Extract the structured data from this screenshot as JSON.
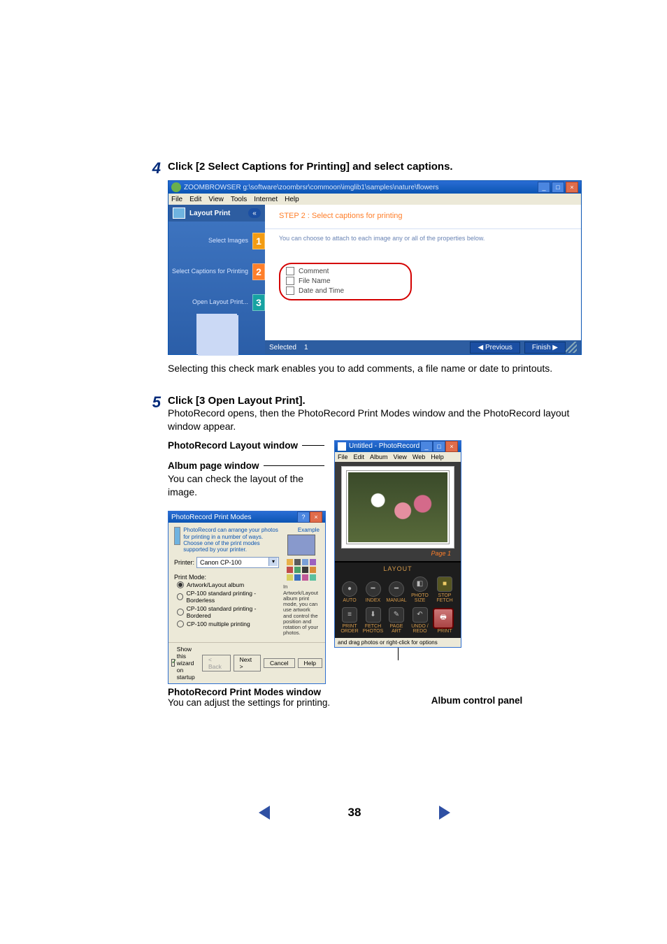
{
  "page_number": "38",
  "step4": {
    "num": "4",
    "title": "Click [2 Select Captions for Printing] and select captions.",
    "caption": "Selecting this check mark enables you to add comments, a file name or date to printouts."
  },
  "step5": {
    "num": "5",
    "title": "Click [3 Open Layout Print].",
    "body": "PhotoRecord opens, then the PhotoRecord Print Modes window and the PhotoRecord layout window appear."
  },
  "labels": {
    "layout_window": "PhotoRecord Layout window",
    "album_page": "Album page window",
    "album_page_desc": "You can check the layout of the image.",
    "print_modes": "PhotoRecord Print Modes window",
    "print_modes_desc": "You can adjust the settings for printing.",
    "album_control": "Album control panel"
  },
  "shot1": {
    "title": "ZOOMBROWSER g:\\software\\zoombrsr\\commoon\\imglib1\\samples\\nature\\flowers",
    "menus": [
      "File",
      "Edit",
      "View",
      "Tools",
      "Internet",
      "Help"
    ],
    "sidebar": {
      "header": "Layout Print",
      "items": [
        {
          "label": "Select Images",
          "num": "1"
        },
        {
          "label": "Select Captions for Printing",
          "num": "2"
        },
        {
          "label": "Open Layout Print...",
          "num": "3"
        }
      ]
    },
    "main": {
      "step_header": "STEP 2 : Select captions for printing",
      "instruction": "You can choose to attach to each image any or all of the properties below.",
      "checks": [
        "Comment",
        "File Name",
        "Date and Time"
      ]
    },
    "status": {
      "selected_label": "Selected",
      "selected_value": "1",
      "previous": "Previous",
      "finish": "Finish"
    },
    "win_buttons": {
      "min": "_",
      "max": "□",
      "close": "×"
    }
  },
  "pmodes": {
    "title": "PhotoRecord Print Modes",
    "intro": "PhotoRecord can arrange your photos for printing in a number of ways. Choose one of the print modes supported by your printer.",
    "printer_label": "Printer:",
    "printer_value": "Canon CP-100",
    "example_label": "Example",
    "mode_label": "Print Mode:",
    "modes": [
      "Artwork/Layout album",
      "CP-100 standard printing - Borderless",
      "CP-100 standard printing - Bordered",
      "CP-100 multiple printing"
    ],
    "mode_note": "In Artwork/Layout album print mode, you can use artwork and control the position and rotation of your photos.",
    "show_wizard": "Show this wizard on startup",
    "buttons": {
      "back": "< Back",
      "next": "Next >",
      "cancel": "Cancel",
      "help": "Help"
    },
    "tb_btn_help": "?",
    "tb_btn_close": "×",
    "swatch_colors": [
      "#e8b04a",
      "#5a5a5a",
      "#7aa0d8",
      "#9c60c0",
      "#c04a4a",
      "#4aa06a",
      "#3a3a3a",
      "#d88a3a",
      "#d8d060",
      "#3a70c0",
      "#c05a9a",
      "#5ac0a0"
    ]
  },
  "photorec": {
    "title": "Untitled - PhotoRecord",
    "menus": [
      "File",
      "Edit",
      "Album",
      "View",
      "Web",
      "Help"
    ],
    "page_label": "Page 1",
    "panel_title": "LAYOUT",
    "cols_top": [
      "AUTO",
      "INDEX",
      "MANUAL",
      "PHOTO SIZE"
    ],
    "stop_fetch": "STOP FETCH",
    "cols_bot": [
      "PRINT ORDER",
      "FETCH PHOTOS",
      "PAGE ART",
      "UNDO / REDO"
    ],
    "print": "PRINT",
    "hint": "and drag photos or right-click for options",
    "win_buttons": {
      "min": "_",
      "max": "□",
      "close": "×"
    }
  }
}
